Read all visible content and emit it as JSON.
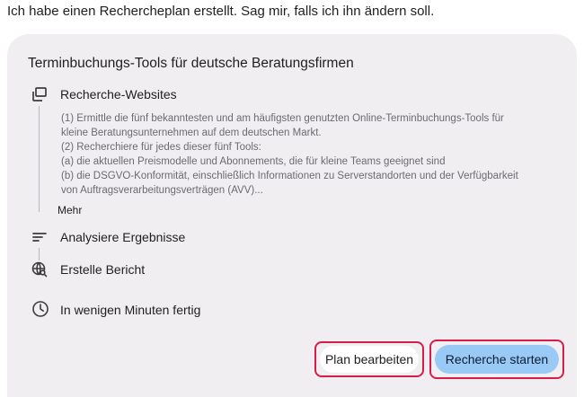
{
  "intro_message": "Ich habe einen Rechercheplan erstellt. Sag mir, falls ich ihn ändern soll.",
  "plan": {
    "title": "Terminbuchungs-Tools für deutsche Beratungsfirmen",
    "steps": [
      {
        "icon": "stacked-windows-icon",
        "label": "Recherche-Websites",
        "description_lines": [
          "(1) Ermittle die fünf bekanntesten und am häufigsten genutzten Online-Terminbuchungs-Tools für",
          "kleine Beratungsunternehmen auf dem deutschen Markt.",
          "(2) Recherchiere für jedes dieser fünf Tools:",
          "(a) die aktuellen Preismodelle und Abonnements, die für kleine Teams geeignet sind",
          "(b) die DSGVO-Konformität, einschließlich Informationen zu Serverstandorten und der Verfügbarkeit",
          "von Auftragsverarbeitungsverträgen (AVV)..."
        ],
        "more_label": "Mehr"
      },
      {
        "icon": "sort-lines-icon",
        "label": "Analysiere Ergebnisse"
      },
      {
        "icon": "globe-search-icon",
        "label": "Erstelle Bericht"
      }
    ],
    "eta": {
      "icon": "clock-icon",
      "label": "In wenigen Minuten fertig"
    }
  },
  "actions": {
    "edit_label": "Plan bearbeiten",
    "start_label": "Recherche starten"
  },
  "colors": {
    "card_background": "#f0eef1",
    "primary_button": "#99c9f5",
    "highlight_border": "#d81b4a",
    "description_text": "#6b6a70"
  }
}
